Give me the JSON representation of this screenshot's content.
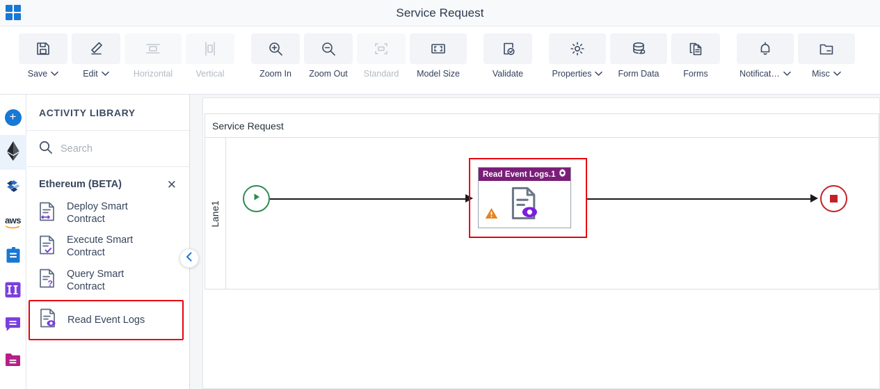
{
  "titlebar": {
    "app_icon": "grid-apps-icon",
    "title": "Service Request"
  },
  "toolbar": {
    "items": [
      {
        "id": "save",
        "label": "Save",
        "icon": "floppy-save-icon",
        "caret": "⌄",
        "disabled": false
      },
      {
        "id": "edit",
        "label": "Edit",
        "icon": "pencil-edit-icon",
        "caret": "⌄",
        "disabled": false
      },
      {
        "id": "horizontal",
        "label": "Horizontal",
        "icon": "horizontal-align-icon",
        "caret": "",
        "disabled": true
      },
      {
        "id": "vertical",
        "label": "Vertical",
        "icon": "vertical-align-icon",
        "caret": "",
        "disabled": true
      },
      {
        "id": "zoom-in",
        "label": "Zoom In",
        "icon": "zoom-in-icon",
        "caret": "",
        "disabled": false
      },
      {
        "id": "zoom-out",
        "label": "Zoom Out",
        "icon": "zoom-out-icon",
        "caret": "",
        "disabled": false
      },
      {
        "id": "standard",
        "label": "Standard",
        "icon": "standard-size-icon",
        "caret": "",
        "disabled": true
      },
      {
        "id": "model-size",
        "label": "Model Size",
        "icon": "model-size-icon",
        "caret": "",
        "disabled": false
      },
      {
        "id": "validate",
        "label": "Validate",
        "icon": "validate-check-icon",
        "caret": "",
        "disabled": false
      },
      {
        "id": "properties",
        "label": "Properties",
        "icon": "gear-icon",
        "caret": "⌄",
        "disabled": false
      },
      {
        "id": "form-data",
        "label": "Form Data",
        "icon": "database-icon",
        "caret": "",
        "disabled": false
      },
      {
        "id": "forms",
        "label": "Forms",
        "icon": "forms-copy-icon",
        "caret": "",
        "disabled": false
      },
      {
        "id": "notification",
        "label": "Notificat…",
        "icon": "bell-icon",
        "caret": "⌄",
        "disabled": false
      },
      {
        "id": "misc",
        "label": "Misc",
        "icon": "folder-misc-icon",
        "caret": "⌄",
        "disabled": false
      }
    ]
  },
  "rail": {
    "add_label": "+",
    "items": [
      {
        "id": "add",
        "icon": "plus-circle-icon",
        "active": false
      },
      {
        "id": "ethereum",
        "icon": "ethereum-diamond-icon",
        "active": true
      },
      {
        "id": "hyperledger",
        "icon": "hyperledger-fabric-icon",
        "active": false
      },
      {
        "id": "aws",
        "icon": "aws-logo-icon",
        "active": false,
        "text": "aws"
      },
      {
        "id": "tasks",
        "icon": "clipboard-icon",
        "active": false
      },
      {
        "id": "columns",
        "icon": "columns-ii-icon",
        "active": false,
        "text": "II"
      },
      {
        "id": "messages",
        "icon": "chat-bubble-icon",
        "active": false
      },
      {
        "id": "files",
        "icon": "folder-icon",
        "active": false
      }
    ]
  },
  "library": {
    "title": "ACTIVITY LIBRARY",
    "search": {
      "value": "",
      "placeholder": "Search",
      "icon": "search-icon"
    },
    "group": {
      "name": "Ethereum (BETA)",
      "close_label": "✕"
    },
    "items": [
      {
        "id": "deploy-smart-contract",
        "label": "Deploy Smart Contract",
        "icon": "document-arrows-icon",
        "highlighted": false
      },
      {
        "id": "execute-smart-contract",
        "label": "Execute Smart Contract",
        "icon": "document-check-icon",
        "highlighted": false
      },
      {
        "id": "query-smart-contract",
        "label": "Query Smart Contract",
        "icon": "document-question-icon",
        "highlighted": false
      },
      {
        "id": "read-event-logs",
        "label": "Read Event Logs",
        "icon": "document-eye-icon",
        "highlighted": true
      }
    ],
    "collapse_icon": "chevron-left-icon"
  },
  "canvas": {
    "pool_title": "Service Request",
    "lane_label": "Lane1",
    "start_node": {
      "icon": "start-play-icon",
      "color": "#2e8b4f"
    },
    "end_node": {
      "icon": "end-stop-icon",
      "color": "#c52026"
    },
    "task": {
      "title": "Read Event Logs.1",
      "header_color": "#7a1e78",
      "gear_icon": "gear-icon",
      "body_icon": "document-eye-icon",
      "warning_icon": "warning-triangle-icon",
      "highlight_color": "#e8000d"
    }
  }
}
